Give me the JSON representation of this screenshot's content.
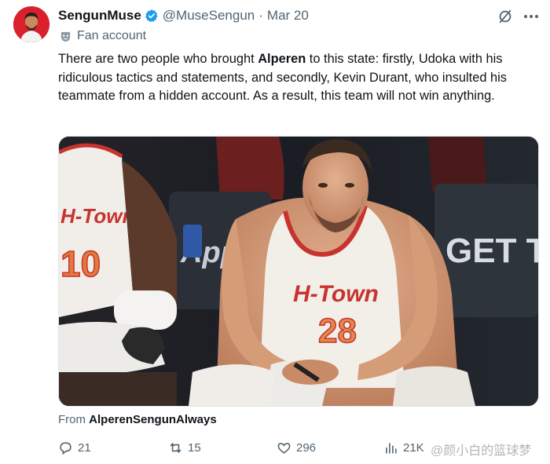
{
  "tweet": {
    "display_name": "SengunMuse",
    "handle": "@MuseSengun",
    "separator": "·",
    "date": "Mar 20",
    "label": "Fan account",
    "text": {
      "p1": "There are two people who brought ",
      "bold": "Alperen",
      "p2": " to this state: firstly, Udoka with his ridiculous tactics and statements, and secondly, Kevin Durant, who insulted his teammate from a hidden account. As a result, this team will not win anything."
    },
    "from_prefix": "From ",
    "from_account": "AlperenSengunAlways",
    "media": {
      "jersey_left_text": "H-Town",
      "jersey_left_number": "10",
      "jersey_main_text": "H-Town",
      "jersey_main_number": "28",
      "signage_left": "App",
      "signage_right": "GET THE"
    }
  },
  "actions": {
    "replies": "21",
    "reposts": "15",
    "likes": "296",
    "views": "21K"
  },
  "watermark": "@颜小白的篮球梦",
  "icons": {
    "verified": "verified-badge-icon",
    "grok": "grok-icon",
    "more": "more-icon",
    "label": "mask-icon",
    "reply": "reply-icon",
    "repost": "repost-icon",
    "like": "like-icon",
    "views": "views-icon"
  },
  "colors": {
    "verified_blue": "#1d9bf0",
    "secondary_text": "#536471",
    "jersey_red": "#c8332f"
  }
}
